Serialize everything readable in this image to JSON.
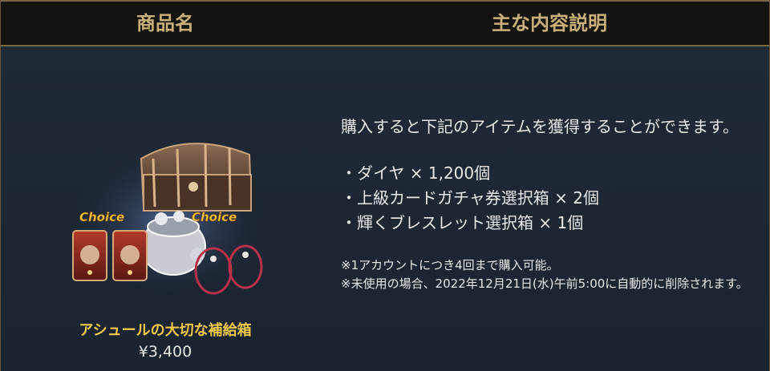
{
  "header": {
    "col_product": "商品名",
    "col_description": "主な内容説明"
  },
  "product": {
    "name": "アシュールの大切な補給箱",
    "price": "¥3,400",
    "choice_badge_left": "Choice",
    "choice_badge_right": "Choice",
    "image_icon": "treasure-chest-bundle-icon"
  },
  "description": {
    "intro": "購入すると下記のアイテムを獲得することができます。",
    "items": [
      "・ダイヤ × 1,200個",
      "・上級カードガチャ券選択箱 × 2個",
      "・輝くブレスレット選択箱 × 1個"
    ],
    "notes": [
      "※1アカウントにつき4回まで購入可能。",
      "※未使用の場合、2022年12月21日(水)午前5:00に自動的に削除されます。"
    ]
  },
  "colors": {
    "header_bg": "#15130f",
    "header_text": "#c9b07a",
    "border_gold": "#7a6742",
    "body_bg": "#1c2530",
    "product_name": "#f2c84a"
  }
}
